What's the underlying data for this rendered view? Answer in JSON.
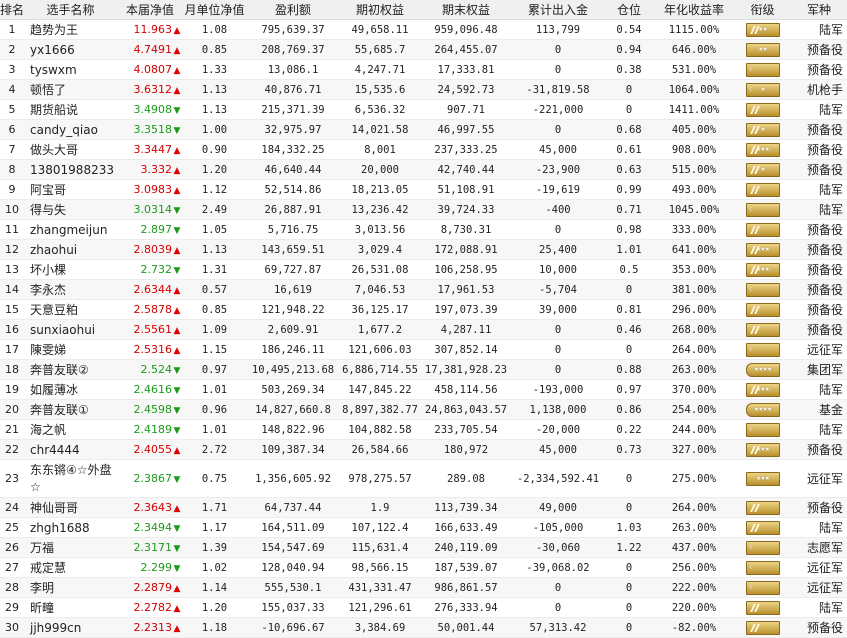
{
  "headers": [
    "排名",
    "选手名称",
    "本届净值",
    "月单位净值",
    "盈利额",
    "期初权益",
    "期末权益",
    "累计出入金",
    "仓位",
    "年化收益率",
    "衔级",
    "军种"
  ],
  "rows": [
    {
      "rank": "1",
      "name": "趋势为王",
      "nav": "11.963",
      "dir": "up",
      "month": "1.08",
      "profit": "795,639.37",
      "start": "49,658.11",
      "end": "959,096.48",
      "flow": "113,799",
      "pos": "0.54",
      "annual": "1115.00%",
      "rank_icon": "stripe-stars-2",
      "army": "陆军"
    },
    {
      "rank": "2",
      "name": "yx1666",
      "nav": "4.7491",
      "dir": "up",
      "month": "0.85",
      "profit": "208,769.37",
      "start": "55,685.7",
      "end": "264,455.07",
      "flow": "0",
      "pos": "0.94",
      "annual": "646.00%",
      "rank_icon": "stars-2",
      "army": "预备役"
    },
    {
      "rank": "3",
      "name": "tyswxm",
      "nav": "4.0807",
      "dir": "up",
      "month": "1.33",
      "profit": "13,086.1",
      "start": "4,247.71",
      "end": "17,333.81",
      "flow": "0",
      "pos": "0.38",
      "annual": "531.00%",
      "rank_icon": "chevron-plain",
      "army": "预备役"
    },
    {
      "rank": "4",
      "name": "顿悟了",
      "nav": "3.6312",
      "dir": "up",
      "month": "1.13",
      "profit": "40,876.71",
      "start": "15,535.6",
      "end": "24,592.73",
      "flow": "-31,819.58",
      "pos": "0",
      "annual": "1064.00%",
      "rank_icon": "chevron-star-1",
      "army": "机枪手"
    },
    {
      "rank": "5",
      "name": "期货船说",
      "nav": "3.4908",
      "dir": "down",
      "month": "1.13",
      "profit": "215,371.39",
      "start": "6,536.32",
      "end": "907.71",
      "flow": "-221,000",
      "pos": "0",
      "annual": "1411.00%",
      "rank_icon": "stripe-plain",
      "army": "陆军"
    },
    {
      "rank": "6",
      "name": "candy_qiao",
      "nav": "3.3518",
      "dir": "down",
      "month": "1.00",
      "profit": "32,975.97",
      "start": "14,021.58",
      "end": "46,997.55",
      "flow": "0",
      "pos": "0.68",
      "annual": "405.00%",
      "rank_icon": "stripe-star-1",
      "army": "预备役"
    },
    {
      "rank": "7",
      "name": "做头大哥",
      "nav": "3.3447",
      "dir": "up",
      "month": "0.90",
      "profit": "184,332.25",
      "start": "8,001",
      "end": "237,333.25",
      "flow": "45,000",
      "pos": "0.61",
      "annual": "908.00%",
      "rank_icon": "stripe-stars-3",
      "army": "预备役"
    },
    {
      "rank": "8",
      "name": "13801988233",
      "nav": "3.332",
      "dir": "up",
      "month": "1.20",
      "profit": "46,640.44",
      "start": "20,000",
      "end": "42,740.44",
      "flow": "-23,900",
      "pos": "0.63",
      "annual": "515.00%",
      "rank_icon": "stripe-star-1",
      "army": "预备役"
    },
    {
      "rank": "9",
      "name": "阿宝哥",
      "nav": "3.0983",
      "dir": "up",
      "month": "1.12",
      "profit": "52,514.86",
      "start": "18,213.05",
      "end": "51,108.91",
      "flow": "-19,619",
      "pos": "0.99",
      "annual": "493.00%",
      "rank_icon": "stripe-plain",
      "army": "陆军"
    },
    {
      "rank": "10",
      "name": "得与失",
      "nav": "3.0314",
      "dir": "down",
      "month": "2.49",
      "profit": "26,887.91",
      "start": "13,236.42",
      "end": "39,724.33",
      "flow": "-400",
      "pos": "0.71",
      "annual": "1045.00%",
      "rank_icon": "chevron-plain",
      "army": "陆军"
    },
    {
      "rank": "11",
      "name": "zhangmeijun",
      "nav": "2.897",
      "dir": "down",
      "month": "1.05",
      "profit": "5,716.75",
      "start": "3,013.56",
      "end": "8,730.31",
      "flow": "0",
      "pos": "0.98",
      "annual": "333.00%",
      "rank_icon": "stripe-plain",
      "army": "预备役"
    },
    {
      "rank": "12",
      "name": "zhaohui",
      "nav": "2.8039",
      "dir": "up",
      "month": "1.13",
      "profit": "143,659.51",
      "start": "3,029.4",
      "end": "172,088.91",
      "flow": "25,400",
      "pos": "1.01",
      "annual": "641.00%",
      "rank_icon": "stripe-stars-3",
      "army": "预备役"
    },
    {
      "rank": "13",
      "name": "坏小棵",
      "nav": "2.732",
      "dir": "down",
      "month": "1.31",
      "profit": "69,727.87",
      "start": "26,531.08",
      "end": "106,258.95",
      "flow": "10,000",
      "pos": "0.5",
      "annual": "353.00%",
      "rank_icon": "stripe-stars-3",
      "army": "预备役"
    },
    {
      "rank": "14",
      "name": "李永杰",
      "nav": "2.6344",
      "dir": "up",
      "month": "0.57",
      "profit": "16,619",
      "start": "7,046.53",
      "end": "17,961.53",
      "flow": "-5,704",
      "pos": "0",
      "annual": "381.00%",
      "rank_icon": "chevron-plain",
      "army": "预备役"
    },
    {
      "rank": "15",
      "name": "天意豆粕",
      "nav": "2.5878",
      "dir": "up",
      "month": "0.85",
      "profit": "121,948.22",
      "start": "36,125.17",
      "end": "197,073.39",
      "flow": "39,000",
      "pos": "0.81",
      "annual": "296.00%",
      "rank_icon": "stripe-plain",
      "army": "预备役"
    },
    {
      "rank": "16",
      "name": "sunxiaohui",
      "nav": "2.5561",
      "dir": "up",
      "month": "1.09",
      "profit": "2,609.91",
      "start": "1,677.2",
      "end": "4,287.11",
      "flow": "0",
      "pos": "0.46",
      "annual": "268.00%",
      "rank_icon": "stripe-plain",
      "army": "预备役"
    },
    {
      "rank": "17",
      "name": "陳雯娣",
      "nav": "2.5316",
      "dir": "up",
      "month": "1.15",
      "profit": "186,246.11",
      "start": "121,606.03",
      "end": "307,852.14",
      "flow": "0",
      "pos": "0",
      "annual": "264.00%",
      "rank_icon": "chevron-plain",
      "army": "远征军"
    },
    {
      "rank": "18",
      "name": "奔普友联②",
      "nav": "2.524",
      "dir": "down",
      "month": "0.97",
      "profit": "10,495,213.68",
      "start": "6,886,714.55",
      "end": "17,381,928.23",
      "flow": "0",
      "pos": "0.88",
      "annual": "263.00%",
      "rank_icon": "round-stars-4",
      "army": "集团军"
    },
    {
      "rank": "19",
      "name": "如履薄冰",
      "nav": "2.4616",
      "dir": "down",
      "month": "1.01",
      "profit": "503,269.34",
      "start": "147,845.22",
      "end": "458,114.56",
      "flow": "-193,000",
      "pos": "0.97",
      "annual": "370.00%",
      "rank_icon": "stripe-stars-3",
      "army": "陆军"
    },
    {
      "rank": "20",
      "name": "奔普友联①",
      "nav": "2.4598",
      "dir": "down",
      "month": "0.96",
      "profit": "14,827,660.8",
      "start": "8,897,382.77",
      "end": "24,863,043.57",
      "flow": "1,138,000",
      "pos": "0.86",
      "annual": "254.00%",
      "rank_icon": "round-stars-4",
      "army": "基金"
    },
    {
      "rank": "21",
      "name": "海之帆",
      "nav": "2.4189",
      "dir": "down",
      "month": "1.01",
      "profit": "148,822.96",
      "start": "104,882.58",
      "end": "233,705.54",
      "flow": "-20,000",
      "pos": "0.22",
      "annual": "244.00%",
      "rank_icon": "chevron-plain",
      "army": "陆军"
    },
    {
      "rank": "22",
      "name": "chr4444",
      "nav": "2.4055",
      "dir": "up",
      "month": "2.72",
      "profit": "109,387.34",
      "start": "26,584.66",
      "end": "180,972",
      "flow": "45,000",
      "pos": "0.73",
      "annual": "327.00%",
      "rank_icon": "stripe-stars-3",
      "army": "预备役"
    },
    {
      "rank": "23",
      "name": "东东锵④☆外盘☆",
      "nav": "2.3867",
      "dir": "down",
      "month": "0.75",
      "profit": "1,356,605.92",
      "start": "978,275.57",
      "end": "289.08",
      "flow": "-2,334,592.41",
      "pos": "0",
      "annual": "275.00%",
      "rank_icon": "stars-3",
      "army": "远征军"
    },
    {
      "rank": "24",
      "name": "神仙哥哥",
      "nav": "2.3643",
      "dir": "up",
      "month": "1.71",
      "profit": "64,737.44",
      "start": "1.9",
      "end": "113,739.34",
      "flow": "49,000",
      "pos": "0",
      "annual": "264.00%",
      "rank_icon": "stripe-plain",
      "army": "预备役"
    },
    {
      "rank": "25",
      "name": "zhgh1688",
      "nav": "2.3494",
      "dir": "down",
      "month": "1.17",
      "profit": "164,511.09",
      "start": "107,122.4",
      "end": "166,633.49",
      "flow": "-105,000",
      "pos": "1.03",
      "annual": "263.00%",
      "rank_icon": "stripe-plain",
      "army": "陆军"
    },
    {
      "rank": "26",
      "name": "万福",
      "nav": "2.3171",
      "dir": "down",
      "month": "1.39",
      "profit": "154,547.69",
      "start": "115,631.4",
      "end": "240,119.09",
      "flow": "-30,060",
      "pos": "1.22",
      "annual": "437.00%",
      "rank_icon": "chevron-plain",
      "army": "志愿军"
    },
    {
      "rank": "27",
      "name": "戒定慧",
      "nav": "2.299",
      "dir": "down",
      "month": "1.02",
      "profit": "128,040.94",
      "start": "98,566.15",
      "end": "187,539.07",
      "flow": "-39,068.02",
      "pos": "0",
      "annual": "256.00%",
      "rank_icon": "chevron-plain",
      "army": "远征军"
    },
    {
      "rank": "28",
      "name": "李明",
      "nav": "2.2879",
      "dir": "up",
      "month": "1.14",
      "profit": "555,530.1",
      "start": "431,331.47",
      "end": "986,861.57",
      "flow": "0",
      "pos": "0",
      "annual": "222.00%",
      "rank_icon": "chevron-plain",
      "army": "远征军"
    },
    {
      "rank": "29",
      "name": "昕疃",
      "nav": "2.2782",
      "dir": "up",
      "month": "1.20",
      "profit": "155,037.33",
      "start": "121,296.61",
      "end": "276,333.94",
      "flow": "0",
      "pos": "0",
      "annual": "220.00%",
      "rank_icon": "stripe-plain",
      "army": "陆军"
    },
    {
      "rank": "30",
      "name": "jjh999cn",
      "nav": "2.2313",
      "dir": "up",
      "month": "1.18",
      "profit": "-10,696.67",
      "start": "3,384.69",
      "end": "50,001.44",
      "flow": "57,313.42",
      "pos": "0",
      "annual": "-82.00%",
      "rank_icon": "stripe-plain",
      "army": "预备役"
    }
  ]
}
